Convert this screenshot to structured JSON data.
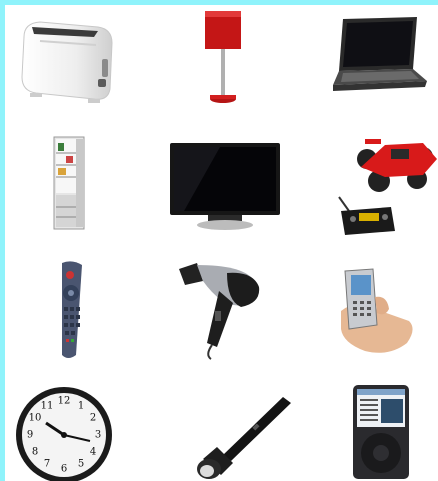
{
  "grid": {
    "columns": 3,
    "rows": 4,
    "items": [
      {
        "icon": "toaster-icon"
      },
      {
        "icon": "table-lamp-icon"
      },
      {
        "icon": "laptop-icon"
      },
      {
        "icon": "refrigerator-icon"
      },
      {
        "icon": "flat-tv-icon"
      },
      {
        "icon": "rc-car-icon"
      },
      {
        "icon": "remote-control-icon"
      },
      {
        "icon": "hair-dryer-icon"
      },
      {
        "icon": "mobile-phone-icon"
      },
      {
        "icon": "wall-clock-icon"
      },
      {
        "icon": "flashlight-icon"
      },
      {
        "icon": "mp3-player-icon"
      }
    ]
  },
  "clock": {
    "numerals": [
      "12",
      "1",
      "2",
      "3",
      "4",
      "5",
      "6",
      "7",
      "8",
      "9",
      "10",
      "11"
    ]
  },
  "colors": {
    "border": "#8ff3fb",
    "lamp_red": "#cc1a1a",
    "car_red": "#d81a1a"
  }
}
